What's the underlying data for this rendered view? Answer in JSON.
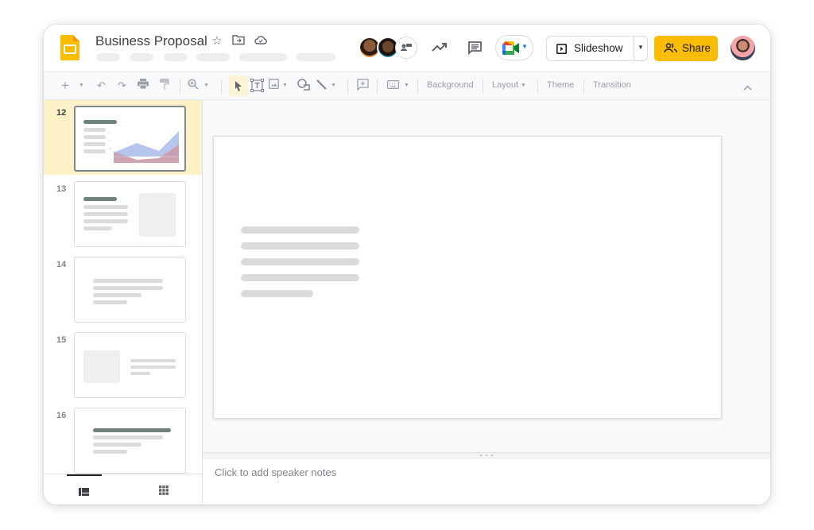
{
  "app": {
    "name": "Google Slides",
    "title": "Business Proposal",
    "brand_color": "#fbbc04"
  },
  "header": {
    "title_icons": [
      "star-icon",
      "move-to-folder-icon",
      "cloud-saved-icon"
    ],
    "menu_placeholders": 6,
    "collaborators": [
      "collaborator-1",
      "collaborator-2",
      "anonymous-viewers"
    ],
    "activity_icon": "trending-up-icon",
    "comments_icon": "comment-icon",
    "meet_icon": "google-meet-icon",
    "slideshow_label": "Slideshow",
    "share_label": "Share",
    "share_color": "#fbbc04"
  },
  "toolbar": {
    "icons": [
      "new-slide-icon",
      "undo-icon",
      "redo-icon",
      "print-icon",
      "paint-format-icon",
      "zoom-icon",
      "select-icon",
      "text-box-icon",
      "image-icon",
      "shape-icon",
      "line-icon",
      "comment-add-icon",
      "input-tools-icon"
    ],
    "background_label": "Background",
    "layout_label": "Layout",
    "theme_label": "Theme",
    "transition_label": "Transition"
  },
  "sidebar": {
    "slides": [
      {
        "number": "12",
        "active": true,
        "type": "chart"
      },
      {
        "number": "13",
        "active": false,
        "type": "text-image"
      },
      {
        "number": "14",
        "active": false,
        "type": "text-centered"
      },
      {
        "number": "15",
        "active": false,
        "type": "image-text"
      },
      {
        "number": "16",
        "active": false,
        "type": "title-text"
      }
    ],
    "view_modes": [
      "filmstrip-view",
      "grid-view"
    ]
  },
  "notes": {
    "placeholder": "Click to add speaker notes"
  }
}
